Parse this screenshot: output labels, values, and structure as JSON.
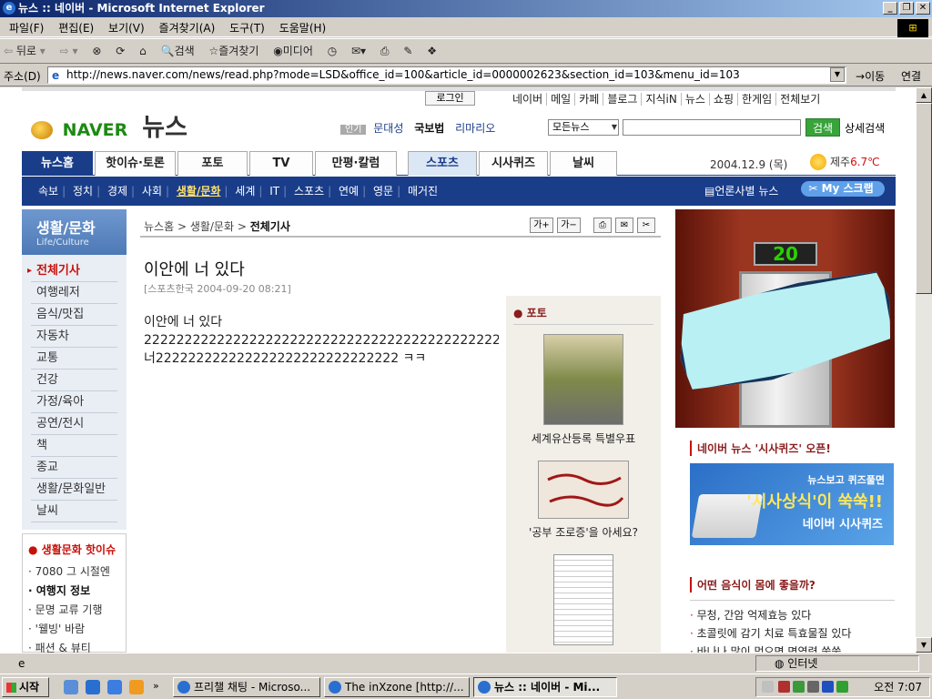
{
  "window": {
    "title": "뉴스 :: 네이버 - Microsoft Internet Explorer"
  },
  "menu": [
    "파일(F)",
    "편집(E)",
    "보기(V)",
    "즐겨찾기(A)",
    "도구(T)",
    "도움말(H)"
  ],
  "toolbar": {
    "back": "뒤로",
    "search": "검색",
    "favorites": "즐겨찾기",
    "media": "미디어"
  },
  "address": {
    "label": "주소(D)",
    "url": "http://news.naver.com/news/read.php?mode=LSD&office_id=100&article_id=0000002623&section_id=103&menu_id=103",
    "go": "이동",
    "links": "연결"
  },
  "page": {
    "login": "로그인",
    "toplinks": [
      "네이버",
      "메일",
      "카페",
      "블로그",
      "지식iN",
      "뉴스",
      "쇼핑",
      "한게임",
      "전체보기"
    ],
    "logo": {
      "brand": "NAVER",
      "section": "뉴스"
    },
    "popular": {
      "tag": "인기",
      "items": [
        "문대성",
        "국보법",
        "리마리오"
      ]
    },
    "search": {
      "scope": "모든뉴스",
      "button": "검색",
      "advanced": "상세검색"
    },
    "nav1": [
      "뉴스홈",
      "핫이슈·토론",
      "포토",
      "TV",
      "만평·칼럼",
      "스포츠",
      "시사퀴즈",
      "날씨"
    ],
    "date": "2004.12.9 (목)",
    "weather": {
      "city": "제주",
      "temp": "6.7℃"
    },
    "nav2": [
      "속보",
      "정치",
      "경제",
      "사회",
      "생활/문화",
      "세계",
      "IT",
      "스포츠",
      "연예",
      "영문",
      "매거진"
    ],
    "nav2_right": {
      "bias": "언론사별 뉴스",
      "scrap": "My 스크랩"
    },
    "lnb": {
      "title": "생활/문화",
      "subtitle": "Life/Culture",
      "items": [
        "전체기사",
        "여행레저",
        "음식/맛집",
        "자동차",
        "교통",
        "건강",
        "가정/육아",
        "공연/전시",
        "책",
        "종교",
        "생활/문화일반",
        "날씨"
      ]
    },
    "hot": {
      "title": "생활문화 핫이슈",
      "items": [
        "7080 그 시절엔",
        "여행지 정보",
        "문명 교류 기행",
        "'웰빙' 바람",
        "패션 & 뷰티"
      ]
    },
    "breadcrumb": {
      "home": "뉴스홈",
      "section": "생활/문화",
      "current": "전체기사"
    },
    "article": {
      "headline": "이안에 너 있다",
      "source": "[스포츠한국 2004-09-20 08:21]",
      "lines": [
        "이안에 너 있다",
        "22222222222222222222222222222222222222222222222222222",
        "너222222222222222222222222222222  ㅋㅋ"
      ]
    },
    "photo": {
      "title": "포토",
      "captions": [
        "세계유산등록 특별우표",
        "'공부 조로증'을 아세요?"
      ]
    },
    "ad": {
      "panel": "20"
    },
    "quiz": {
      "title": "네이버 뉴스 '시사퀴즈' 오픈!",
      "banner_top": "뉴스보고 퀴즈풀면",
      "banner_main": "'시사상식'이 쑥쑥!!",
      "banner_bottom": "네이버 시사퀴즈"
    },
    "food": {
      "title": "어떤 음식이 몸에 좋을까?",
      "items": [
        "무청, 간암 억제효능 있다",
        "초콜릿에 감기 치료 특효물질 있다",
        "바나나 많이 먹으면 면역력 쑥쑥"
      ]
    }
  },
  "status": {
    "zone": "인터넷"
  },
  "taskbar": {
    "start": "시작",
    "tasks": [
      "프리챌 채팅 - Microso...",
      "The inXzone [http://...",
      "뉴스 :: 네이버 - Mi..."
    ],
    "clock": "오전 7:07"
  }
}
